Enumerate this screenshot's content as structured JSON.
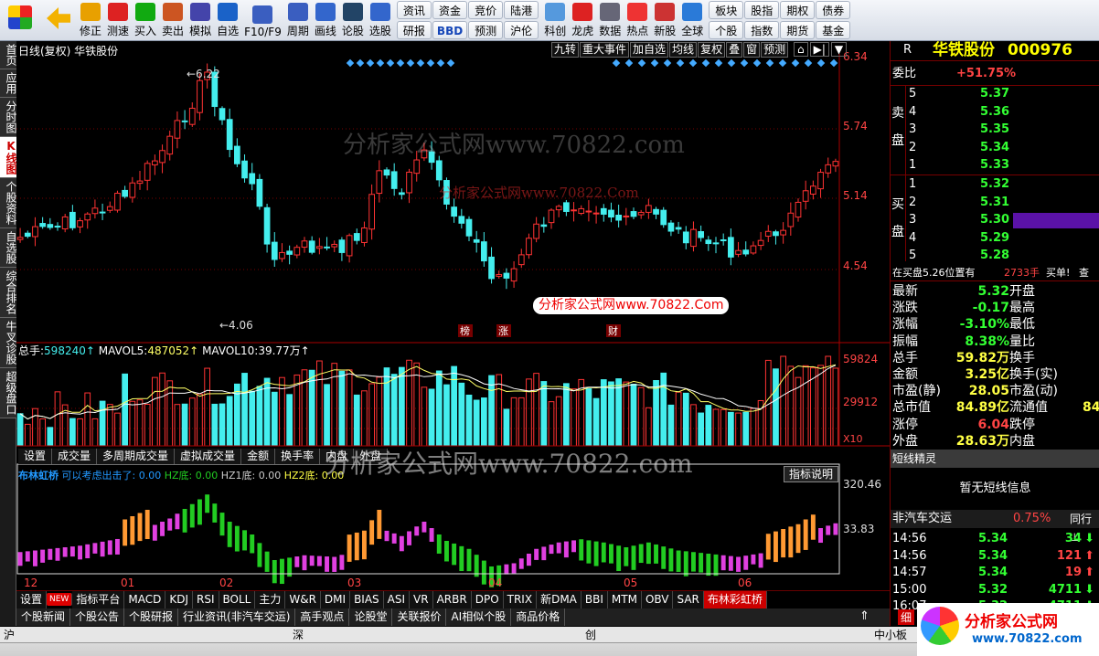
{
  "toolbar": {
    "buttons": [
      "修正",
      "测速",
      "买入",
      "卖出",
      "模拟",
      "自选",
      "F10/F9",
      "周期",
      "画线",
      "论股",
      "选股"
    ],
    "grid": [
      "资讯",
      "研报",
      "资金",
      "BBD",
      "竞价",
      "预测",
      "陆港",
      "沪伦"
    ],
    "buttons2": [
      "科创",
      "龙虎",
      "数据",
      "热点",
      "新股",
      "全球"
    ],
    "grid2": [
      "板块",
      "个股",
      "股指",
      "指数",
      "期权",
      "期货",
      "债券",
      "基金"
    ]
  },
  "lefttabs": [
    "首页",
    "应用",
    "分时图",
    "K线图",
    "个股资料",
    "自选股",
    "综合排名",
    "牛叉诊股",
    "超级盘口"
  ],
  "header": {
    "title": "日线(复权) 华铁股份",
    "buttons": [
      "九转",
      "重大事件",
      "加自选",
      "均线",
      "复权",
      "叠",
      "窗",
      "预测"
    ]
  },
  "price_axis": [
    "6.34",
    "5.74",
    "5.14",
    "4.54"
  ],
  "price_labels": {
    "high": "6.22",
    "low": "4.06"
  },
  "events": [
    "榜",
    "涨",
    "财"
  ],
  "volume": {
    "title": "总手:",
    "total": "598240↑",
    "ma5_label": "MAVOL5:",
    "ma5": "487052↑",
    "ma10_label": "MAVOL10:",
    "ma10": "39.77万↑",
    "axis": [
      "59824",
      "29912",
      "X10"
    ]
  },
  "vol_tabs": [
    "设置",
    "成交量",
    "多周期成交量",
    "虚拟成交量",
    "金额",
    "换手率",
    "内盘",
    "外盘"
  ],
  "indicator": {
    "legend": "布林虹桥",
    "legend2": "可以考虑出击了: 0.00",
    "hz": "HZ底: 0.00",
    "hz1": "HZ1底: 0.00",
    "hz2": "HZ2底: 0.00",
    "button": "指标说明",
    "axis": [
      "320.46",
      "33.83"
    ]
  },
  "months": [
    "12",
    "01",
    "02",
    "03",
    "04",
    "05",
    "06"
  ],
  "bottom_tabs": [
    "设置",
    "NEW",
    "指标平台",
    "MACD",
    "KDJ",
    "RSI",
    "BOLL",
    "主力",
    "W&R",
    "DMI",
    "BIAS",
    "ASI",
    "VR",
    "ARBR",
    "DPO",
    "TRIX",
    "新DMA",
    "BBI",
    "MTM",
    "OBV",
    "SAR",
    "布林彩虹桥"
  ],
  "news_tabs": [
    "个股新闻",
    "个股公告",
    "个股研报",
    "行业资讯(非汽车交运)",
    "高手观点",
    "论股堂",
    "关联报价",
    "AI相似个股",
    "商品价格"
  ],
  "watermarks": [
    "分析家公式网www.70822.com",
    "分析家公式网www.70822.Com",
    "分析家公式网www.70822.Com",
    "分析家公式网www.70822.com"
  ],
  "quote": {
    "tag": "R",
    "name": "华铁股份",
    "code": "000976",
    "weibi_label": "委比",
    "weibi": "+51.75%",
    "sell_label": "卖盘",
    "buy_label": "买盘",
    "sell": [
      {
        "n": "5",
        "p": "5.37"
      },
      {
        "n": "4",
        "p": "5.36"
      },
      {
        "n": "3",
        "p": "5.35"
      },
      {
        "n": "2",
        "p": "5.34"
      },
      {
        "n": "1",
        "p": "5.33"
      }
    ],
    "buy": [
      {
        "n": "1",
        "p": "5.32"
      },
      {
        "n": "2",
        "p": "5.31"
      },
      {
        "n": "3",
        "p": "5.30"
      },
      {
        "n": "4",
        "p": "5.29"
      },
      {
        "n": "5",
        "p": "5.28"
      }
    ],
    "note": "在买盘5.26位置有",
    "note_val": "2733手",
    "note_tail": "买单!",
    "note_end": "查",
    "stats": [
      {
        "l": "最新",
        "v": "5.32",
        "r": "开盘"
      },
      {
        "l": "涨跌",
        "v": "-0.17",
        "r": "最高"
      },
      {
        "l": "涨幅",
        "v": "-3.10%",
        "r": "最低"
      },
      {
        "l": "振幅",
        "v": "8.38%",
        "r": "量比"
      },
      {
        "l": "总手",
        "v": "59.82万",
        "r": "换手"
      },
      {
        "l": "金额",
        "v": "3.25亿",
        "r": "换手(实)"
      },
      {
        "l": "市盈(静)",
        "v": "28.05",
        "r": "市盈(动)"
      },
      {
        "l": "总市值",
        "v": "84.89亿",
        "r": "流通值",
        "rv": "84"
      },
      {
        "l": "涨停",
        "v": "6.04",
        "r": "跌停"
      },
      {
        "l": "外盘",
        "v": "28.63万",
        "r": "内盘"
      }
    ],
    "short_title": "短线精灵",
    "short_msg": "暂无短线信息",
    "trade_title": "非汽车交运",
    "trade_pct": "0.75%",
    "trade_tab": "同行⊥",
    "ticks": [
      {
        "t": "14:56",
        "p": "5.34",
        "v": "34"
      },
      {
        "t": "14:56",
        "p": "5.34",
        "v": "121"
      },
      {
        "t": "14:57",
        "p": "5.34",
        "v": "19"
      },
      {
        "t": "15:00",
        "p": "5.32",
        "v": "4711"
      },
      {
        "t": "16:07",
        "p": "5.32",
        "v": "4711"
      }
    ],
    "xi": "细"
  },
  "status": [
    "沪",
    "深",
    "创",
    "中小板"
  ],
  "logo": "分析家公式网",
  "logo_url": "www.70822.com"
}
